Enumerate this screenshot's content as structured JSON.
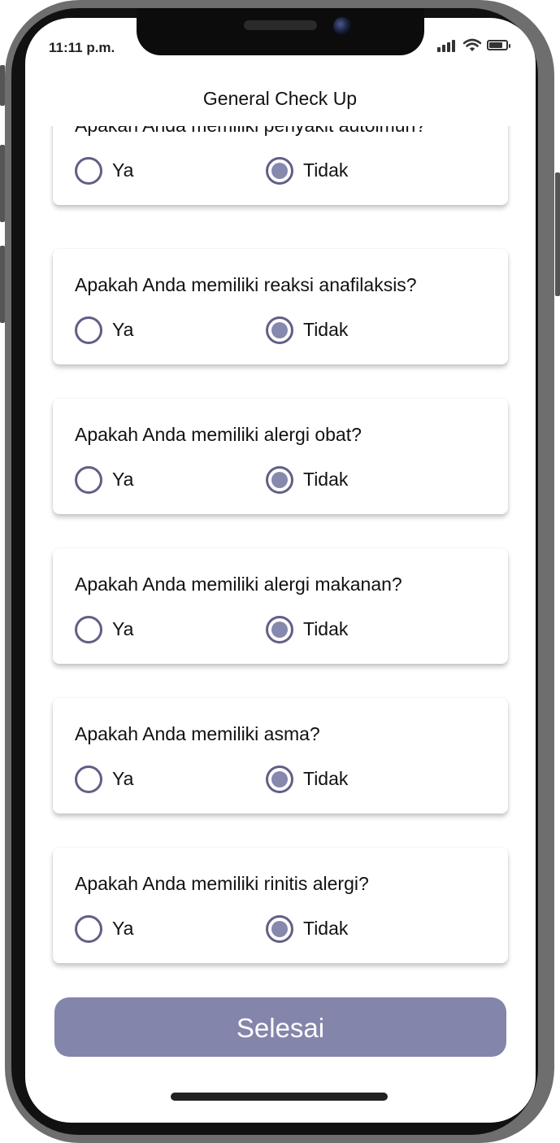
{
  "status_bar": {
    "time": "11:11 p.m.",
    "icons": [
      "signal-icon",
      "wifi-icon",
      "battery-icon"
    ]
  },
  "header": {
    "title": "General Check Up"
  },
  "questions": [
    {
      "text": "Apakah Anda memiliki penyakit autoimun?",
      "options": [
        "Ya",
        "Tidak"
      ],
      "selected": "Tidak"
    },
    {
      "text": "Apakah Anda memiliki reaksi anafilaksis?",
      "options": [
        "Ya",
        "Tidak"
      ],
      "selected": "Tidak"
    },
    {
      "text": "Apakah Anda memiliki alergi obat?",
      "options": [
        "Ya",
        "Tidak"
      ],
      "selected": "Tidak"
    },
    {
      "text": "Apakah Anda memiliki alergi makanan?",
      "options": [
        "Ya",
        "Tidak"
      ],
      "selected": "Tidak"
    },
    {
      "text": "Apakah Anda memiliki asma?",
      "options": [
        "Ya",
        "Tidak"
      ],
      "selected": "Tidak"
    },
    {
      "text": "Apakah Anda memiliki rinitis alergi?",
      "options": [
        "Ya",
        "Tidak"
      ],
      "selected": "Tidak"
    }
  ],
  "submit": {
    "label": "Selesai"
  },
  "colors": {
    "accent": "#8485ab",
    "radio_border": "#625e85",
    "radio_fill": "#8688ad"
  }
}
